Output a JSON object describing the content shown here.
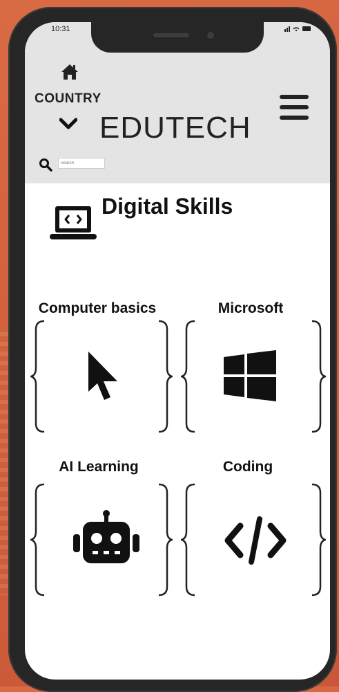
{
  "status": {
    "time": "10:31",
    "icons": "..ıl ᯤ ▬"
  },
  "header": {
    "home_icon": "home-icon",
    "country_label": "COUNTRY",
    "brand": "EDUTECH",
    "search_placeholder": "Search"
  },
  "page": {
    "title": "Digital Skills",
    "title_icon": "laptop-code-icon"
  },
  "cards": [
    {
      "label": "Computer basics",
      "icon": "mouse-pointer-icon"
    },
    {
      "label": "Microsoft",
      "icon": "windows-logo-icon"
    },
    {
      "label": "AI Learning",
      "icon": "robot-icon"
    },
    {
      "label": "Coding",
      "icon": "code-icon"
    }
  ],
  "colors": {
    "accent_bg": "#d2633d",
    "header_bg": "#e4e4e4",
    "phone_frame": "#262626"
  }
}
